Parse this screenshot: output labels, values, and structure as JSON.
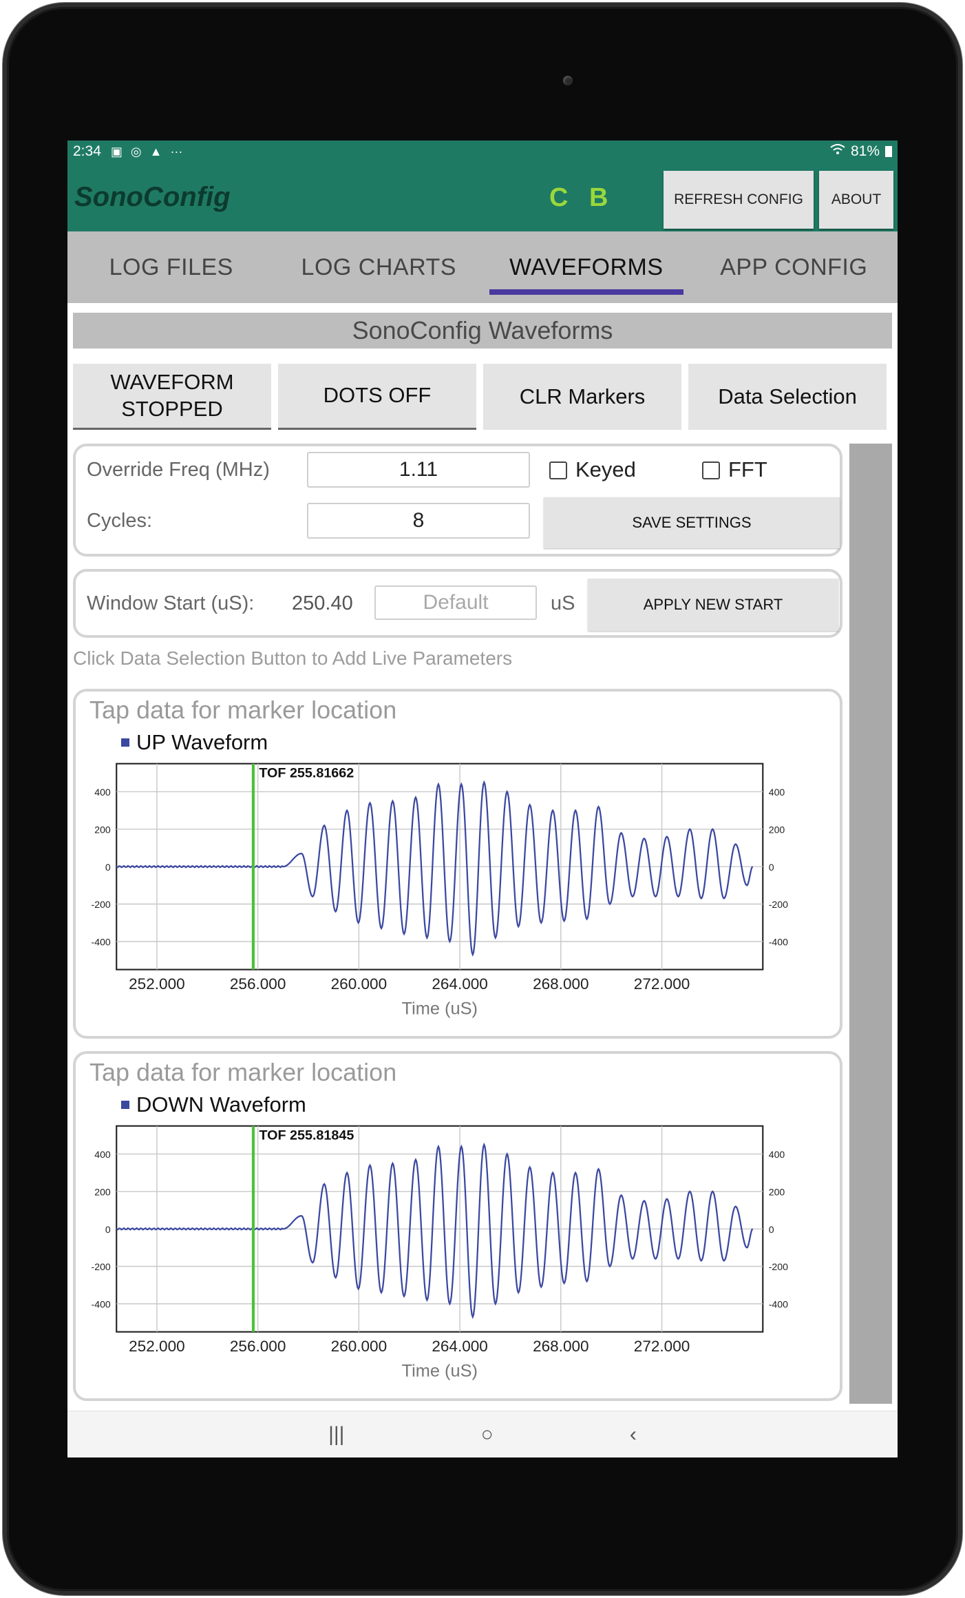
{
  "status_bar": {
    "time": "2:34",
    "icons": [
      "gallery-icon",
      "sync-icon",
      "warning-icon",
      "more-icon"
    ],
    "more": "···",
    "battery": "81%"
  },
  "app_bar": {
    "title": "SonoConfig",
    "indicator_c": "C",
    "indicator_b": "B",
    "refresh_label": "REFRESH CONFIG",
    "about_label": "ABOUT",
    "colors": {
      "bar": "#1f7a64",
      "title": "#0c3b2e",
      "indicator": "#9ad83a"
    }
  },
  "tabs": [
    {
      "label": "LOG FILES",
      "active": false
    },
    {
      "label": "LOG CHARTS",
      "active": false
    },
    {
      "label": "WAVEFORMS",
      "active": true
    },
    {
      "label": "APP CONFIG",
      "active": false
    }
  ],
  "section_title": "SonoConfig Waveforms",
  "action_buttons": {
    "waveform": "WAVEFORM\nSTOPPED",
    "dots": "DOTS OFF",
    "clear": "CLR Markers",
    "data_selection": "Data Selection"
  },
  "settings": {
    "override_freq_label": "Override Freq (MHz)",
    "override_freq_value": "1.11",
    "keyed_label": "Keyed",
    "keyed_checked": false,
    "fft_label": "FFT",
    "fft_checked": false,
    "cycles_label": "Cycles:",
    "cycles_value": "8",
    "save_label": "SAVE SETTINGS"
  },
  "window": {
    "label": "Window Start (uS):",
    "value": "250.40",
    "placeholder": "Default",
    "unit": "uS",
    "apply_label": "APPLY NEW START"
  },
  "hint": "Click Data Selection Button to Add Live Parameters",
  "charts": {
    "up": {
      "tap_hint": "Tap data for marker location",
      "legend": "UP Waveform",
      "tof_label": "TOF 255.81662",
      "xlabel": "Time (uS)"
    },
    "down": {
      "tap_hint": "Tap data for marker location",
      "legend": "DOWN Waveform",
      "tof_label": "TOF 255.81845",
      "xlabel": "Time (uS)"
    }
  },
  "chart_data": [
    {
      "type": "line",
      "series": [
        {
          "name": "UP Waveform",
          "color": "#3b48a0"
        }
      ],
      "marker_x": 255.81662,
      "xlim": [
        250.4,
        276.0
      ],
      "ylim": [
        -550,
        550
      ],
      "xticks": [
        "252.000",
        "256.000",
        "260.000",
        "264.000",
        "268.000",
        "272.000"
      ],
      "xtick_values": [
        252,
        256,
        260,
        264,
        268,
        272
      ],
      "yticks": [
        "400",
        "200",
        "0",
        "-200",
        "-400"
      ],
      "ytick_values": [
        400,
        200,
        0,
        -200,
        -400
      ],
      "xlabel": "Time (uS)",
      "grid": true,
      "peaks": [
        [
          257.0,
          0
        ],
        [
          257.73,
          70
        ],
        [
          258.17,
          -160
        ],
        [
          258.63,
          220
        ],
        [
          259.08,
          -240
        ],
        [
          259.53,
          300
        ],
        [
          259.98,
          -300
        ],
        [
          260.44,
          340
        ],
        [
          260.89,
          -330
        ],
        [
          261.34,
          350
        ],
        [
          261.79,
          -360
        ],
        [
          262.25,
          370
        ],
        [
          262.7,
          -380
        ],
        [
          263.15,
          440
        ],
        [
          263.6,
          -400
        ],
        [
          264.06,
          440
        ],
        [
          264.51,
          -470
        ],
        [
          264.96,
          450
        ],
        [
          265.41,
          -380
        ],
        [
          265.87,
          400
        ],
        [
          266.32,
          -320
        ],
        [
          266.77,
          330
        ],
        [
          267.22,
          -300
        ],
        [
          267.68,
          300
        ],
        [
          268.13,
          -290
        ],
        [
          268.58,
          300
        ],
        [
          269.03,
          -280
        ],
        [
          269.49,
          320
        ],
        [
          269.94,
          -200
        ],
        [
          270.39,
          180
        ],
        [
          270.84,
          -160
        ],
        [
          271.3,
          150
        ],
        [
          271.75,
          -160
        ],
        [
          272.2,
          160
        ],
        [
          272.65,
          -160
        ],
        [
          273.11,
          200
        ],
        [
          273.56,
          -170
        ],
        [
          274.01,
          200
        ],
        [
          274.46,
          -170
        ],
        [
          274.92,
          120
        ],
        [
          275.37,
          -100
        ],
        [
          275.6,
          0
        ]
      ]
    },
    {
      "type": "line",
      "series": [
        {
          "name": "DOWN Waveform",
          "color": "#3b48a0"
        }
      ],
      "marker_x": 255.81845,
      "xlim": [
        250.4,
        276.0
      ],
      "ylim": [
        -550,
        550
      ],
      "xticks": [
        "252.000",
        "256.000",
        "260.000",
        "264.000",
        "268.000",
        "272.000"
      ],
      "xtick_values": [
        252,
        256,
        260,
        264,
        268,
        272
      ],
      "yticks": [
        "400",
        "200",
        "0",
        "-200",
        "-400"
      ],
      "ytick_values": [
        400,
        200,
        0,
        -200,
        -400
      ],
      "xlabel": "Time (uS)",
      "grid": true,
      "peaks": [
        [
          257.0,
          0
        ],
        [
          257.73,
          70
        ],
        [
          258.17,
          -180
        ],
        [
          258.63,
          240
        ],
        [
          259.08,
          -260
        ],
        [
          259.53,
          300
        ],
        [
          259.98,
          -320
        ],
        [
          260.44,
          340
        ],
        [
          260.89,
          -340
        ],
        [
          261.34,
          350
        ],
        [
          261.79,
          -360
        ],
        [
          262.25,
          370
        ],
        [
          262.7,
          -380
        ],
        [
          263.15,
          440
        ],
        [
          263.6,
          -400
        ],
        [
          264.06,
          440
        ],
        [
          264.51,
          -470
        ],
        [
          264.96,
          450
        ],
        [
          265.41,
          -400
        ],
        [
          265.87,
          400
        ],
        [
          266.32,
          -340
        ],
        [
          266.77,
          330
        ],
        [
          267.22,
          -310
        ],
        [
          267.68,
          300
        ],
        [
          268.13,
          -290
        ],
        [
          268.58,
          300
        ],
        [
          269.03,
          -280
        ],
        [
          269.49,
          320
        ],
        [
          269.94,
          -200
        ],
        [
          270.39,
          180
        ],
        [
          270.84,
          -160
        ],
        [
          271.3,
          150
        ],
        [
          271.75,
          -160
        ],
        [
          272.2,
          160
        ],
        [
          272.65,
          -160
        ],
        [
          273.11,
          200
        ],
        [
          273.56,
          -170
        ],
        [
          274.01,
          200
        ],
        [
          274.46,
          -170
        ],
        [
          274.92,
          120
        ],
        [
          275.37,
          -100
        ],
        [
          275.6,
          0
        ]
      ]
    }
  ],
  "nav": {
    "recents": "|||",
    "home": "○",
    "back": "‹"
  }
}
